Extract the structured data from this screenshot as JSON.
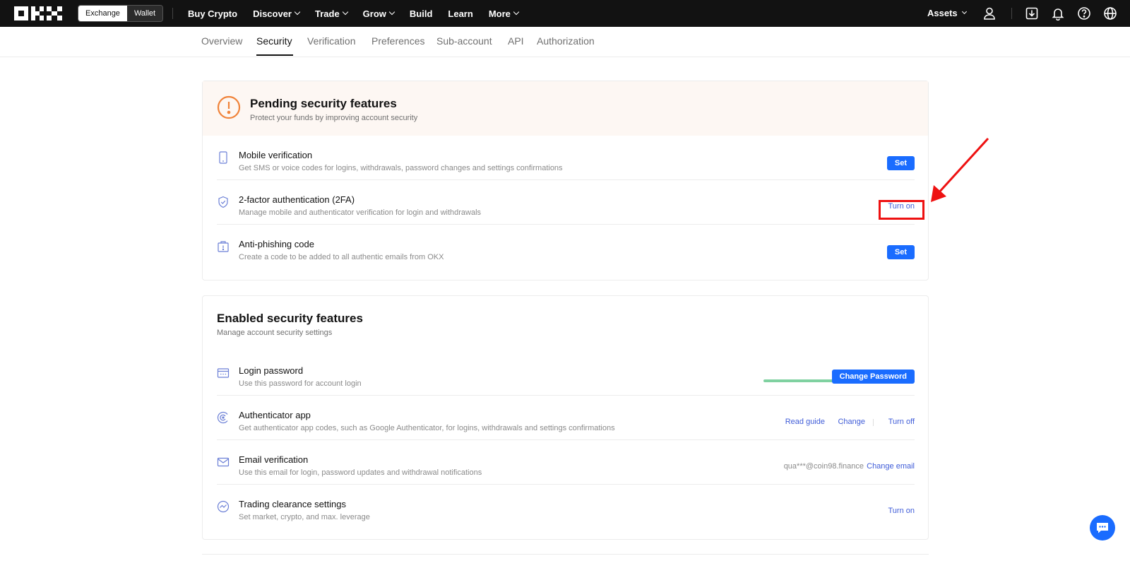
{
  "topnav": {
    "logo_text": "OKX",
    "mode": {
      "exchange": "Exchange",
      "wallet": "Wallet"
    },
    "items": [
      {
        "label": "Buy Crypto",
        "dropdown": false
      },
      {
        "label": "Discover",
        "dropdown": true
      },
      {
        "label": "Trade",
        "dropdown": true
      },
      {
        "label": "Grow",
        "dropdown": true
      },
      {
        "label": "Build",
        "dropdown": false
      },
      {
        "label": "Learn",
        "dropdown": false
      },
      {
        "label": "More",
        "dropdown": true
      }
    ],
    "assets_label": "Assets",
    "icons": [
      "user-icon",
      "download-icon",
      "bell-icon",
      "help-icon",
      "globe-icon"
    ]
  },
  "tabs": [
    {
      "label": "Overview"
    },
    {
      "label": "Security",
      "active": true
    },
    {
      "label": "Verification"
    },
    {
      "label": "Preferences"
    },
    {
      "label": "Sub-account"
    },
    {
      "label": "API"
    },
    {
      "label": "Authorization"
    }
  ],
  "pending": {
    "title": "Pending security features",
    "subtitle": "Protect your funds by improving account security",
    "rows": [
      {
        "icon": "phone-icon",
        "title": "Mobile verification",
        "desc": "Get SMS or voice codes for logins, withdrawals, password changes and settings confirmations",
        "action": "Set"
      },
      {
        "icon": "shield-icon",
        "title": "2-factor authentication (2FA)",
        "desc": "Manage mobile and authenticator verification for login and withdrawals",
        "action": "Turn on"
      },
      {
        "icon": "anti-phishing-icon",
        "title": "Anti-phishing code",
        "desc": "Create a code to be added to all authentic emails from OKX",
        "action": "Set"
      }
    ]
  },
  "enabled": {
    "title": "Enabled security features",
    "subtitle": "Manage account security settings",
    "rows": [
      {
        "icon": "password-icon",
        "title": "Login password",
        "desc": "Use this password for account login",
        "action": "Change Password",
        "strength": 1.0
      },
      {
        "icon": "authenticator-icon",
        "title": "Authenticator app",
        "desc": "Get authenticator app codes, such as Google Authenticator, for logins, withdrawals and settings confirmations",
        "links": [
          "Read guide",
          "Change",
          "Turn off"
        ]
      },
      {
        "icon": "mail-icon",
        "title": "Email verification",
        "desc": "Use this email for login, password updates and withdrawal notifications",
        "value": "qua***@coin98.finance",
        "action": "Change email"
      },
      {
        "icon": "trading-icon",
        "title": "Trading clearance settings",
        "desc": "Set market, crypto, and max. leverage",
        "action": "Turn on"
      }
    ]
  },
  "colors": {
    "accent": "#1a6cff",
    "link": "#3f5cd8",
    "warning": "#f0833a",
    "annotation": "#ee1111",
    "strength": "#7fd1a0"
  }
}
